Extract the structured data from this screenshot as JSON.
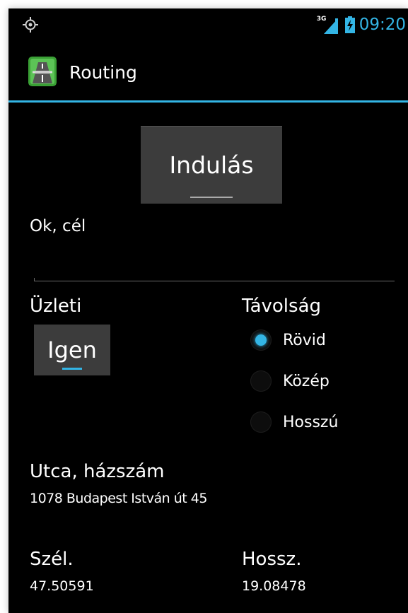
{
  "status_bar": {
    "network_type": "3G",
    "time": "09:20",
    "gps_icon": "gps-target-icon",
    "signal_icon": "signal-bars-icon",
    "battery_icon": "battery-charging-icon"
  },
  "action_bar": {
    "app_icon": "highway-road-icon",
    "title": "Routing"
  },
  "main": {
    "start_button_label": "Indulás",
    "ok_label": "Ok, cél",
    "business": {
      "label": "Üzleti",
      "toggle_value": "Igen"
    },
    "distance": {
      "label": "Távolság",
      "options": [
        {
          "label": "Rövid",
          "checked": true
        },
        {
          "label": "Közép",
          "checked": false
        },
        {
          "label": "Hosszú",
          "checked": false
        }
      ]
    },
    "address": {
      "label": "Utca, házszám",
      "value": "1078 Budapest István út 45"
    },
    "latitude": {
      "label": "Szél.",
      "value": "47.50591"
    },
    "longitude": {
      "label": "Hossz.",
      "value": "19.08478"
    }
  },
  "colors": {
    "accent": "#33b5e5",
    "background": "#000000",
    "button": "#3c3c3c",
    "text": "#ffffff"
  }
}
